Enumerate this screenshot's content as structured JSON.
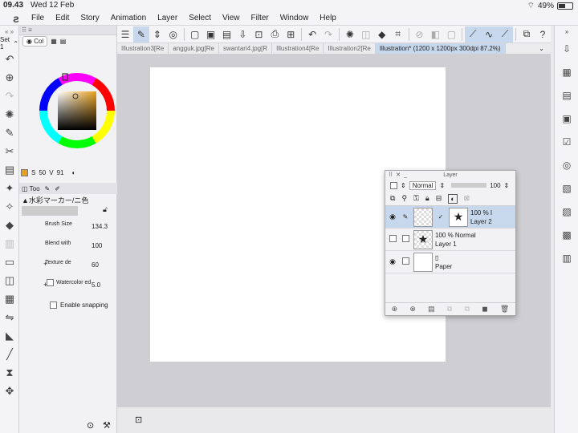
{
  "status": {
    "time": "09.43",
    "date": "Wed 12 Feb",
    "battery": "49%"
  },
  "menu": [
    "File",
    "Edit",
    "Story",
    "Animation",
    "Layer",
    "Select",
    "View",
    "Filter",
    "Window",
    "Help"
  ],
  "toolcol": {
    "set_label": "Set 1"
  },
  "color_panel": {
    "tab_label": "Col",
    "values": {
      "s_label": "S",
      "s": "50",
      "v_label": "V",
      "v": "91"
    },
    "main_color": "#e8a020"
  },
  "tool_props": {
    "tab_label": "Too",
    "tool_name": "▲水彩マーカー/ニ色",
    "brush_size": {
      "label": "Brush Size",
      "value": "134.3"
    },
    "blend_with": {
      "label": "Blend with",
      "value": "100"
    },
    "texture_density": {
      "label": "Texture de",
      "value": "60"
    },
    "watercolor_edge": {
      "label": "Watercolor ed",
      "value": "5.0"
    },
    "enable_snapping": "Enable snapping"
  },
  "doc_tabs": [
    "Illustration3[Re",
    "angguk.jpg[Re",
    "swantari4.jpg[R",
    "Illustration4[Re",
    "Illustration2[Re",
    "Illustration* (1200 x 1200px 300dpi 87.2%)"
  ],
  "layer_panel": {
    "title": "Layer",
    "blend_mode": "Normal",
    "opacity": "100",
    "layers": [
      {
        "opacity": "100 % I",
        "name": "Layer 2",
        "selected": true,
        "visible": true
      },
      {
        "opacity": "100 % Normal",
        "name": "Layer 1",
        "selected": false,
        "visible": false
      },
      {
        "opacity": "",
        "name": "Paper",
        "selected": false,
        "visible": true
      }
    ]
  },
  "colors": {
    "accent": "#c8d8ec",
    "canvas_bg": "#cfcfd3"
  }
}
